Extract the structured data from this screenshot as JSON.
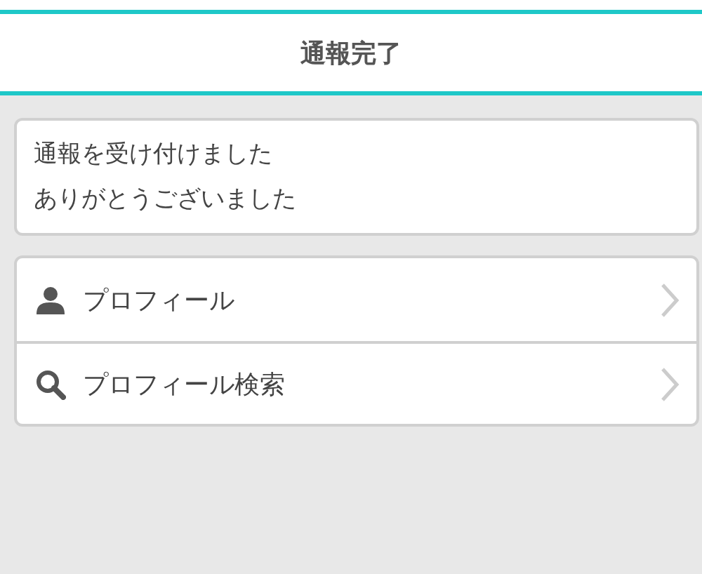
{
  "header": {
    "title": "通報完了"
  },
  "message": {
    "lines": [
      "通報を受け付けました",
      "ありがとうございました"
    ]
  },
  "menu": [
    {
      "kind": "person",
      "label": "プロフィール"
    },
    {
      "kind": "search",
      "label": "プロフィール検索"
    }
  ]
}
